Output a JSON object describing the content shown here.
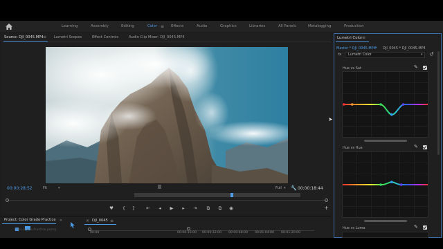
{
  "workspaces": {
    "tabs": [
      "Learning",
      "Assembly",
      "Editing",
      "Color",
      "Effects",
      "Audio",
      "Graphics",
      "Libraries",
      "All Panels",
      "Metalogging",
      "Production"
    ],
    "active": "Color",
    "menu_glyph": "≡"
  },
  "source_panel": {
    "tabs": [
      "Source: DJI_0045.MP4",
      "Lumetri Scopes",
      "Effect Controls",
      "Audio Clip Mixer: DJI_0045.MP4"
    ],
    "menu_glyph": "≡",
    "current_timecode": "00:00:28:52",
    "duration_timecode": "00:00:18:44",
    "fit_label": "Fit",
    "resolution_label": "Full",
    "add_glyph": "+"
  },
  "transport_controls": {
    "glyphs": [
      "♥",
      "{",
      "}",
      "⇤",
      "◂",
      "▶",
      "▸",
      "⇥",
      "⧉",
      "⧉",
      "◉"
    ]
  },
  "project_panel": {
    "tab_label": "Project: Color Grade Practice",
    "menu_glyph": "»",
    "faint_text": "Color Grade Practice.prproj"
  },
  "sequence_panel": {
    "close_glyph": "×",
    "tab_label": "DJI_0045",
    "menu_glyph": "≡",
    "timecodes": [
      "00:00",
      "00:00:16:00",
      "00:00:32:00",
      "00:00:48:00",
      "00:01:04:00",
      "00:01:20:00"
    ]
  },
  "lumetri": {
    "title": "Lumetri Color",
    "menu_glyph": "≡",
    "master_label": "Master * DJI_0045.MP4",
    "clip_label": "DJI_0045 * DJI_0045.MP4",
    "fx_label": "fx",
    "effect_name": "Lumetri Color",
    "curves": [
      {
        "label": "Hue vs Sat"
      },
      {
        "label": "Hue vs Hue"
      },
      {
        "label": "Hue vs Luma"
      }
    ]
  },
  "colors": {
    "accent": "#4d9be6",
    "panel_bg": "#1f1f1f",
    "graph_bg": "#141414"
  }
}
